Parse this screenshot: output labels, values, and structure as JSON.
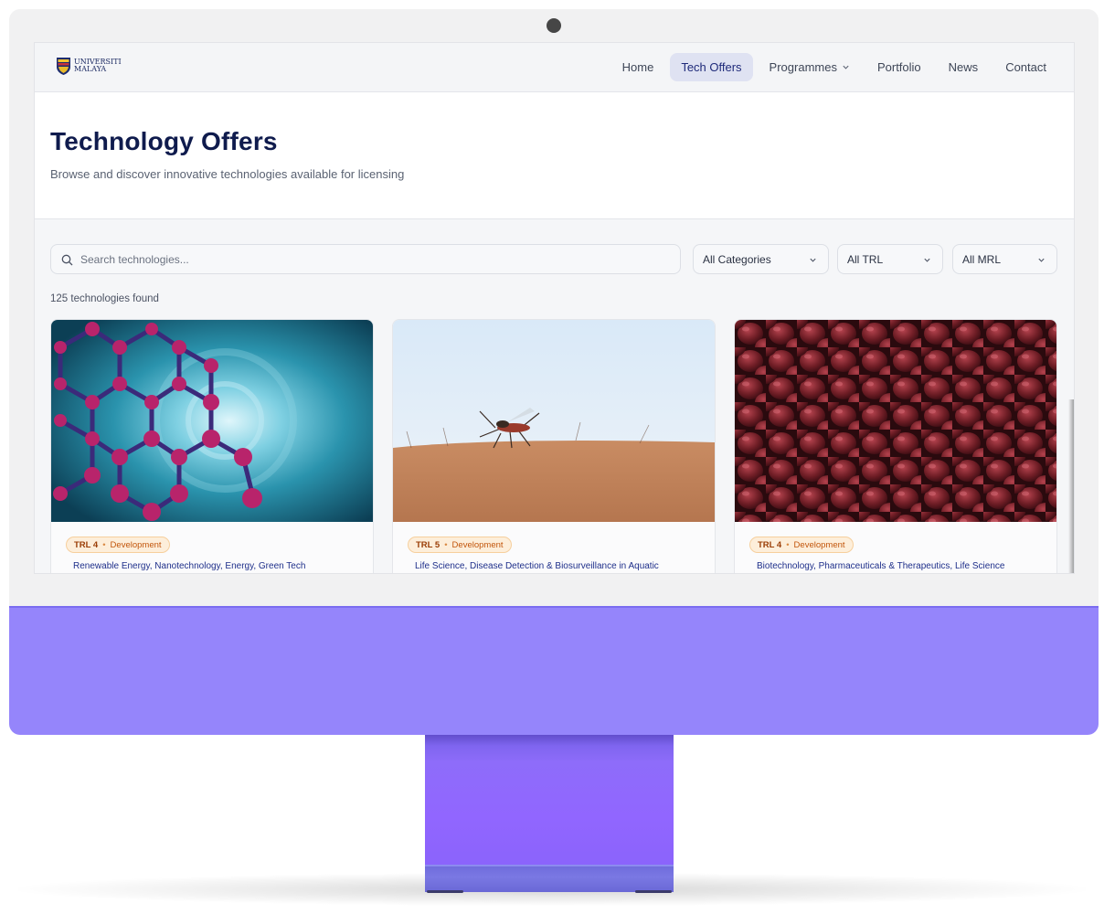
{
  "logo": {
    "line1": "UNIVERSITI",
    "line2": "MALAYA"
  },
  "nav": {
    "home": "Home",
    "tech_offers": "Tech Offers",
    "programmes": "Programmes",
    "portfolio": "Portfolio",
    "news": "News",
    "contact": "Contact",
    "active": "Tech Offers"
  },
  "hero": {
    "title": "Technology Offers",
    "subtitle": "Browse and discover innovative technologies available for licensing"
  },
  "filters": {
    "search_placeholder": "Search technologies...",
    "category": "All Categories",
    "trl": "All TRL",
    "mrl": "All MRL"
  },
  "results": {
    "count_text": "125 technologies found"
  },
  "cards": [
    {
      "image": "nanotube-molecule-image",
      "trl": "TRL 4",
      "stage": "Development",
      "tags": "Renewable Energy, Nanotechnology, Energy, Green Tech"
    },
    {
      "image": "mosquito-on-skin-image",
      "trl": "TRL 5",
      "stage": "Development",
      "tags": "Life Science, Disease Detection & Biosurveillance in Aquatic"
    },
    {
      "image": "shallots-image",
      "trl": "TRL 4",
      "stage": "Development",
      "tags": "Biotechnology, Pharmaceuticals & Therapeutics, Life Science"
    }
  ],
  "colors": {
    "accent": "#1f2a7a",
    "title": "#0f1b4d",
    "badge_bg": "#fdeeda",
    "badge_text": "#c2560c",
    "device_chin": "#9585fb",
    "device_stand": "#9166ff"
  }
}
